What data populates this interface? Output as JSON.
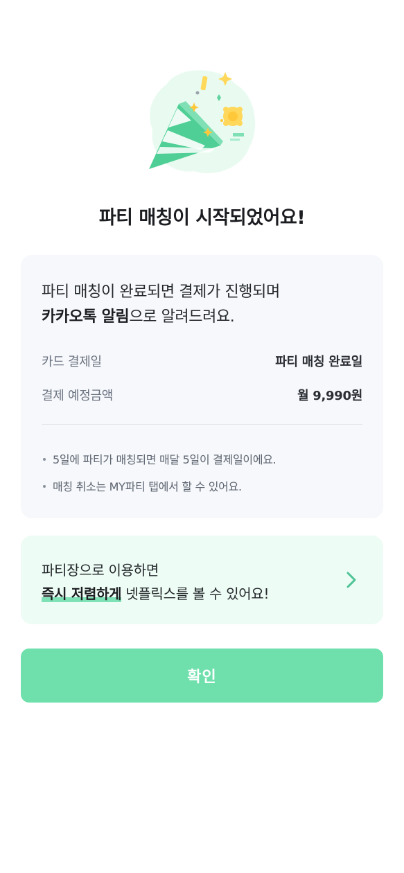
{
  "icons": {
    "hero": "party-popper-icon",
    "chevron": "chevron-right-icon"
  },
  "colors": {
    "accent": "#6fe0ac",
    "promo_bg": "#edfcf4",
    "card_bg": "#f6f8fb",
    "chevron": "#4fc397"
  },
  "title": "파티 매칭이 시작되었어요!",
  "info": {
    "message_line1": "파티 매칭이 완료되면 결제가 진행되며",
    "message_bold": "카카오톡 알림",
    "message_rest": "으로 알려드려요.",
    "rows": [
      {
        "label": "카드 결제일",
        "value": "파티 매칭 완료일"
      },
      {
        "label": "결제 예정금액",
        "value": "월 9,990원"
      }
    ],
    "notes": [
      "5일에 파티가 매칭되면 매달 5일이 결제일이에요.",
      "매칭 취소는 MY파티 탭에서 할 수 있어요."
    ]
  },
  "promo": {
    "line1": "파티장으로 이용하면",
    "highlight": "즉시 저렴하게",
    "line2_rest": " 넷플릭스를 볼 수 있어요!"
  },
  "confirm_label": "확인"
}
